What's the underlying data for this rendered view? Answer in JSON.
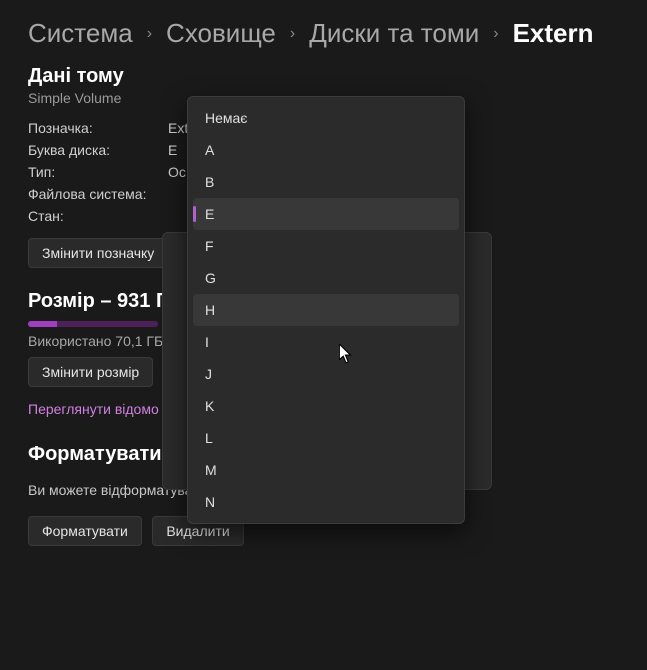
{
  "breadcrumb": {
    "item1": "Система",
    "item2": "Сховище",
    "item3": "Диски та томи",
    "item4": "Extern"
  },
  "volume": {
    "title": "Дані тому",
    "subtitle": "Simple Volume",
    "labels": {
      "label": "Позначка:",
      "letter": "Буква диска:",
      "type": "Тип:",
      "fs": "Файлова система:",
      "state": "Стан:"
    },
    "values": {
      "label": "Ext",
      "letter": "E",
      "type": "Ос",
      "fs": "",
      "state": ""
    },
    "btn_change_label": "Змінити позначку"
  },
  "size": {
    "title": "Розмір – 931 Г",
    "used": "Використано 70,1 ГБ",
    "btn_resize": "Змінити розмір",
    "link_info": "Переглянути відомо"
  },
  "format": {
    "title": "Форматувати",
    "desc": "Ви можете відформатува                                                                             ні.",
    "btn_format": "Форматувати",
    "btn_delete": "Видалити"
  },
  "dropdown": {
    "items": [
      "Немає",
      "A",
      "B",
      "E",
      "F",
      "G",
      "H",
      "I",
      "J",
      "K",
      "L",
      "M",
      "N"
    ],
    "selected": "E",
    "hovered": "H"
  }
}
